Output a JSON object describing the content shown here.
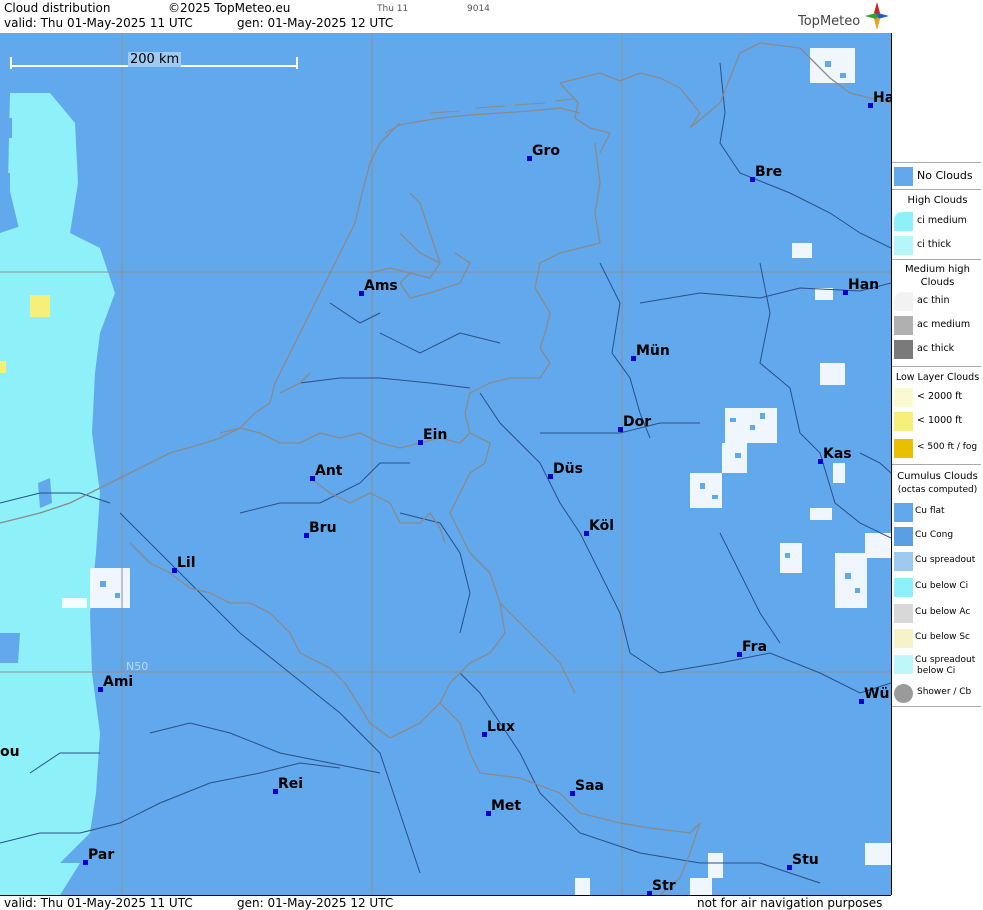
{
  "header": {
    "title": "Cloud distribution",
    "copyright": "©2025 TopMeteo.eu",
    "day_small": "Thu 11",
    "code_small": "9014",
    "valid": "valid:  Thu  01-May-2025  11 UTC",
    "gen": "gen: 01-May-2025 12 UTC",
    "logo": "TopMeteo"
  },
  "footer": {
    "valid": "valid:  Thu  01-May-2025  11 UTC",
    "gen": "gen: 01-May-2025 12 UTC",
    "note": "not for air navigation purposes"
  },
  "map": {
    "scale_label": "200 km",
    "lat_label": "N50",
    "colors": {
      "no_clouds": "#62a8ec",
      "ci": "#8ef0f8",
      "low": "#f6f07a",
      "border": "#8a8a8a",
      "river": "#2a4f86",
      "city_dot": "#0000d0"
    },
    "cities": [
      {
        "name": "Gro"
      },
      {
        "name": "Bre"
      },
      {
        "name": "Ha"
      },
      {
        "name": "Ams"
      },
      {
        "name": "Han"
      },
      {
        "name": "Mün"
      },
      {
        "name": "Dor"
      },
      {
        "name": "Ein"
      },
      {
        "name": "Ant"
      },
      {
        "name": "Düs"
      },
      {
        "name": "Kas"
      },
      {
        "name": "Bru"
      },
      {
        "name": "Köl"
      },
      {
        "name": "Lil"
      },
      {
        "name": "Fra"
      },
      {
        "name": "Ami"
      },
      {
        "name": "Wü"
      },
      {
        "name": "Lux"
      },
      {
        "name": "ou"
      },
      {
        "name": "Rei"
      },
      {
        "name": "Saa"
      },
      {
        "name": "Met"
      },
      {
        "name": "Par"
      },
      {
        "name": "Stu"
      },
      {
        "name": "Str"
      }
    ]
  },
  "legend": {
    "no_clouds": "No Clouds",
    "high_head": "High Clouds",
    "ci_medium": "ci medium",
    "ci_thick": "ci thick",
    "medium_head": "Medium high Clouds",
    "ac_thin": "ac thin",
    "ac_medium": "ac medium",
    "ac_thick": "ac thick",
    "low_head": "Low Layer Clouds",
    "l2000": "< 2000 ft",
    "l1000": "< 1000 ft",
    "l500": "< 500 ft / fog",
    "cu_head": "Cumulus Clouds",
    "cu_sub": "(octas computed)",
    "cu_flat": "Cu flat",
    "cu_cong": "Cu Cong",
    "cu_spread": "Cu spreadout",
    "cu_below_ci": "Cu below Ci",
    "cu_below_ac": "Cu below Ac",
    "cu_below_sc": "Cu below Sc",
    "cu_spread_ci_1": "Cu spreadout",
    "cu_spread_ci_2": "below Ci",
    "shower": "Shower / Cb"
  }
}
